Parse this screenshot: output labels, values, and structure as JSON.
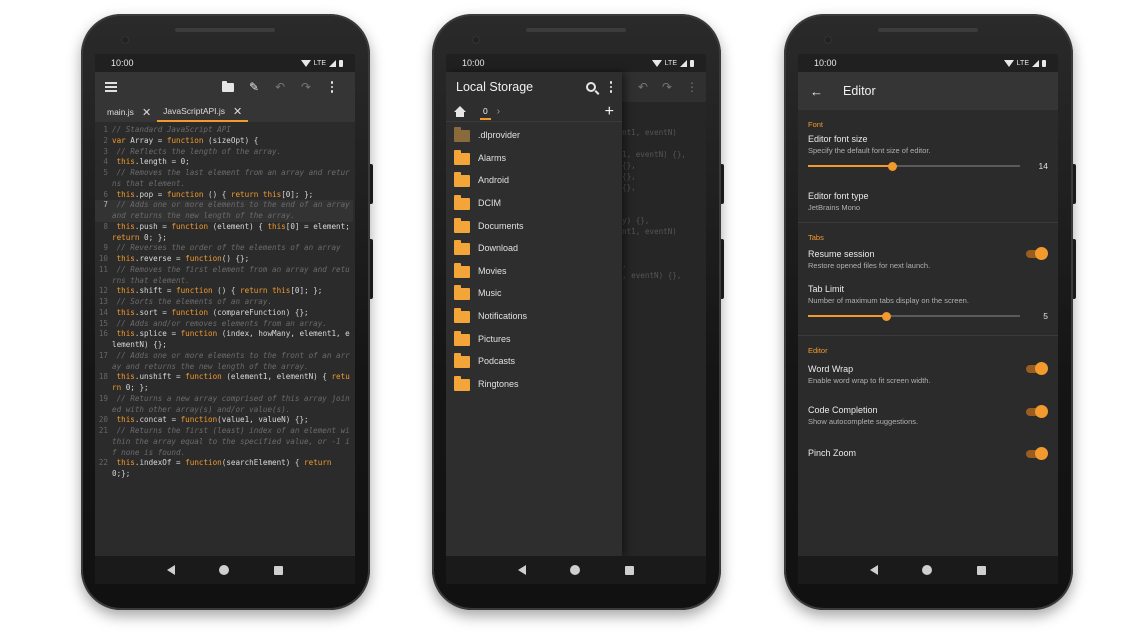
{
  "status": {
    "time": "10:00",
    "network": "LTE"
  },
  "editor": {
    "tabs": [
      {
        "label": "main.js",
        "active": false
      },
      {
        "label": "JavaScriptAPI.js",
        "active": true
      }
    ],
    "lines": [
      {
        "n": "1",
        "t": "// Standard JavaScript API",
        "c": true
      },
      {
        "n": "2",
        "t": "var Array = function (sizeOpt) {"
      },
      {
        "n": "3",
        "t": " // Reflects the length of the array.",
        "c": true
      },
      {
        "n": "4",
        "t": " this.length = 0;"
      },
      {
        "n": "5",
        "t": " // Removes the last element from an array and returns that element.",
        "c": true
      },
      {
        "n": "6",
        "t": " this.pop = function () { return this[0]; };"
      },
      {
        "n": "7",
        "t": " // Adds one or more elements to the end of an array and returns the new length of the array.",
        "c": true,
        "cur": true
      },
      {
        "n": "8",
        "t": " this.push = function (element) { this[0] = element; return 0; };"
      },
      {
        "n": "9",
        "t": " // Reverses the order of the elements of an array",
        "c": true
      },
      {
        "n": "10",
        "t": " this.reverse = function() {};"
      },
      {
        "n": "11",
        "t": " // Removes the first element from an array and returns that element.",
        "c": true
      },
      {
        "n": "12",
        "t": " this.shift = function () { return this[0]; };"
      },
      {
        "n": "13",
        "t": " // Sorts the elements of an array.",
        "c": true
      },
      {
        "n": "14",
        "t": " this.sort = function (compareFunction) {};"
      },
      {
        "n": "15",
        "t": " // Adds and/or removes elements from an array.",
        "c": true
      },
      {
        "n": "16",
        "t": " this.splice = function (index, howMany, element1, elementN) {};"
      },
      {
        "n": "17",
        "t": " // Adds one or more elements to the front of an array and returns the new length of the array.",
        "c": true
      },
      {
        "n": "18",
        "t": " this.unshift = function (element1, elementN) { return 0; };"
      },
      {
        "n": "19",
        "t": " // Returns a new array comprised of this array joined with other array(s) and/or value(s).",
        "c": true
      },
      {
        "n": "20",
        "t": " this.concat = function(value1, valueN) {};"
      },
      {
        "n": "21",
        "t": " // Returns the first (least) index of an element within the array equal to the specified value, or -1 if none is found.",
        "c": true
      },
      {
        "n": "22",
        "t": " this.indexOf = function(searchElement) { return 0;};"
      }
    ]
  },
  "storage": {
    "title": "Local Storage",
    "path_segment": "0",
    "ghost_code": [
      "nt1, eventN)",
      "",
      "1, eventN) {},",
      "{},",
      "{},",
      "{},",
      "",
      "",
      "y) {},",
      "nt1, eventN)",
      "",
      "",
      ",",
      ", eventN) {},"
    ],
    "folders": [
      {
        "name": ".dlprovider",
        "dim": true
      },
      {
        "name": "Alarms"
      },
      {
        "name": "Android"
      },
      {
        "name": "DCIM"
      },
      {
        "name": "Documents"
      },
      {
        "name": "Download"
      },
      {
        "name": "Movies"
      },
      {
        "name": "Music"
      },
      {
        "name": "Notifications"
      },
      {
        "name": "Pictures"
      },
      {
        "name": "Podcasts"
      },
      {
        "name": "Ringtones"
      }
    ]
  },
  "settings": {
    "title": "Editor",
    "sections": {
      "font": "Font",
      "tabs": "Tabs",
      "editor": "Editor"
    },
    "font_size": {
      "title": "Editor font size",
      "subtitle": "Specify the default font size of editor.",
      "value": "14",
      "fraction": 0.4
    },
    "font_type": {
      "title": "Editor font type",
      "subtitle": "JetBrains Mono"
    },
    "resume": {
      "title": "Resume session",
      "subtitle": "Restore opened files for next launch.",
      "on": true
    },
    "tab_limit": {
      "title": "Tab Limit",
      "subtitle": "Number of maximum tabs display on the screen.",
      "value": "5",
      "fraction": 0.37
    },
    "word_wrap": {
      "title": "Word Wrap",
      "subtitle": "Enable word wrap to fit screen width.",
      "on": true
    },
    "completion": {
      "title": "Code Completion",
      "subtitle": "Show autocomplete suggestions.",
      "on": true
    },
    "pinch": {
      "title": "Pinch Zoom",
      "on": true
    }
  },
  "colors": {
    "accent": "#f29a2e",
    "surface": "#2b2b2b",
    "toolbar": "#353535"
  }
}
